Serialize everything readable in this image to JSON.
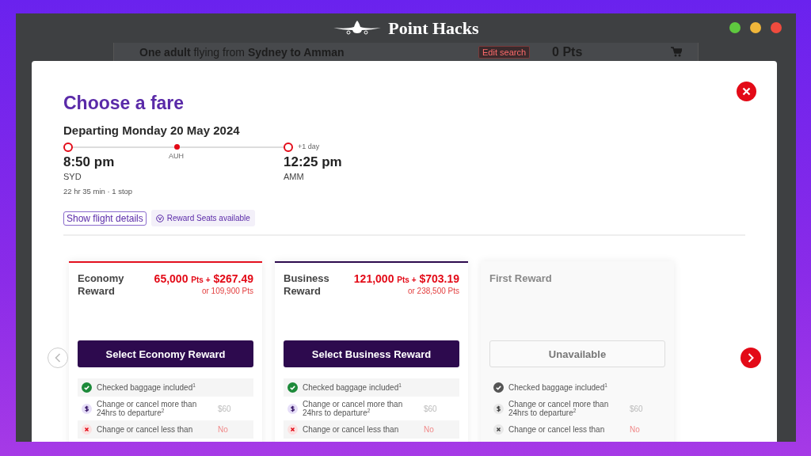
{
  "window": {
    "brand": "Point Hacks"
  },
  "search_bar": {
    "summary": "**One adult** flying from **Sydney to Amman**",
    "edit_button": "Edit search",
    "points": "0 Pts"
  },
  "modal": {
    "title": "Choose a fare",
    "subtitle": "Departing Monday 20 May 2024",
    "flight": {
      "depart_time": "8:50 pm",
      "depart_code": "SYD",
      "stop_code": "AUH",
      "arrive_time": "12:25 pm",
      "arrive_code": "AMM",
      "day_offset": "+1 day",
      "duration": "22 hr 35 min · 1 stop"
    },
    "details_button": "Show flight details",
    "seats_badge": "Reward Seats available",
    "fares": [
      {
        "name": "Economy Reward",
        "available": true,
        "color": "#e3101e",
        "price": {
          "points": "65,000",
          "unit": "Pts",
          "plus": "+",
          "cash": "$267.49"
        },
        "alt_price": "or 109,900 Pts",
        "button": "Select Economy Reward",
        "features": [
          {
            "kind": "included",
            "text": "Checked baggage included$^{1}$"
          },
          {
            "kind": "fee",
            "text": "Change or cancel more than 24hrs to departure$^{2}$",
            "value": "$60"
          },
          {
            "kind": "no",
            "text": "Change or cancel less than",
            "value": "No"
          }
        ]
      },
      {
        "name": "Business Reward",
        "available": true,
        "color": "#2d0a4e",
        "price": {
          "points": "121,000",
          "unit": "Pts",
          "plus": "+",
          "cash": "$703.19"
        },
        "alt_price": "or 238,500 Pts",
        "button": "Select Business Reward",
        "features": [
          {
            "kind": "included",
            "text": "Checked baggage included$^{1}$"
          },
          {
            "kind": "fee",
            "text": "Change or cancel more than 24hrs to departure$^{2}$",
            "value": "$60"
          },
          {
            "kind": "no",
            "text": "Change or cancel less than",
            "value": "No"
          }
        ]
      },
      {
        "name": "First Reward",
        "available": false,
        "button": "Unavailable",
        "features": [
          {
            "kind": "included",
            "text": "Checked baggage included$^{1}$"
          },
          {
            "kind": "fee",
            "text": "Change or cancel more than 24hrs to departure$^{2}$",
            "value": "$60"
          },
          {
            "kind": "no",
            "text": "Change or cancel less than",
            "value": "No"
          }
        ]
      }
    ]
  }
}
